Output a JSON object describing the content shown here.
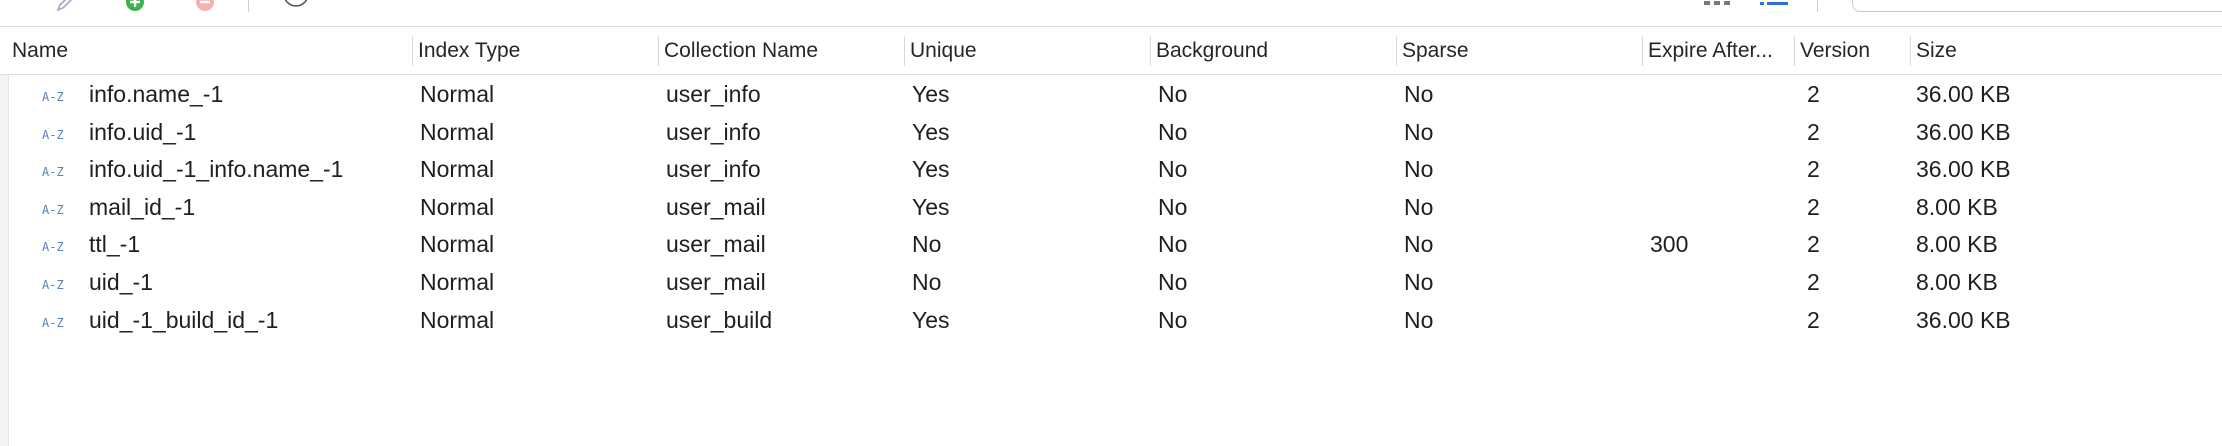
{
  "columns": [
    {
      "label": "Name"
    },
    {
      "label": "Index Type"
    },
    {
      "label": "Collection Name"
    },
    {
      "label": "Unique"
    },
    {
      "label": "Background"
    },
    {
      "label": "Sparse"
    },
    {
      "label": "Expire After..."
    },
    {
      "label": "Version"
    },
    {
      "label": "Size"
    }
  ],
  "rows": [
    {
      "name": "info.name_-1",
      "type": "Normal",
      "collection": "user_info",
      "unique": "Yes",
      "background": "No",
      "sparse": "No",
      "expire": "",
      "version": "2",
      "size": "36.00 KB"
    },
    {
      "name": "info.uid_-1",
      "type": "Normal",
      "collection": "user_info",
      "unique": "Yes",
      "background": "No",
      "sparse": "No",
      "expire": "",
      "version": "2",
      "size": "36.00 KB"
    },
    {
      "name": "info.uid_-1_info.name_-1",
      "type": "Normal",
      "collection": "user_info",
      "unique": "Yes",
      "background": "No",
      "sparse": "No",
      "expire": "",
      "version": "2",
      "size": "36.00 KB"
    },
    {
      "name": "mail_id_-1",
      "type": "Normal",
      "collection": "user_mail",
      "unique": "Yes",
      "background": "No",
      "sparse": "No",
      "expire": "",
      "version": "2",
      "size": "8.00 KB"
    },
    {
      "name": "ttl_-1",
      "type": "Normal",
      "collection": "user_mail",
      "unique": "No",
      "background": "No",
      "sparse": "No",
      "expire": "300",
      "version": "2",
      "size": "8.00 KB"
    },
    {
      "name": "uid_-1",
      "type": "Normal",
      "collection": "user_mail",
      "unique": "No",
      "background": "No",
      "sparse": "No",
      "expire": "",
      "version": "2",
      "size": "8.00 KB"
    },
    {
      "name": "uid_-1_build_id_-1",
      "type": "Normal",
      "collection": "user_build",
      "unique": "Yes",
      "background": "No",
      "sparse": "No",
      "expire": "",
      "version": "2",
      "size": "36.00 KB"
    }
  ],
  "icons": {
    "row_icon": "a-z-sort-icon",
    "row_icon_color": "#5b7fb8",
    "add_color": "#3cb34a",
    "delete_color": "#f0a0a0",
    "accent": "#2f6fd6"
  }
}
